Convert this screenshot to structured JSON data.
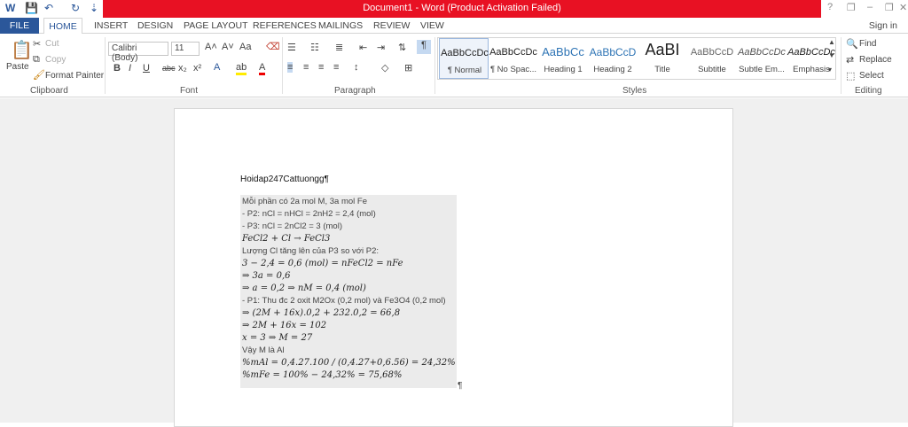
{
  "window": {
    "title": "Document1 - Word (Product Activation Failed)",
    "help": "?",
    "min": "–",
    "restore": "❐",
    "close": "✕"
  },
  "qat": {
    "app_icon": "W",
    "save": "💾",
    "undo": "↶",
    "redo": "↻",
    "more": "⇣"
  },
  "tabs": {
    "file": "FILE",
    "home": "HOME",
    "insert": "INSERT",
    "design": "DESIGN",
    "page_layout": "PAGE LAYOUT",
    "references": "REFERENCES",
    "mailings": "MAILINGS",
    "review": "REVIEW",
    "view": "VIEW",
    "signin": "Sign in"
  },
  "clipboard": {
    "paste": "Paste",
    "cut": "Cut",
    "copy": "Copy",
    "format_painter": "Format Painter",
    "label": "Clipboard"
  },
  "font": {
    "name": "Calibri (Body)",
    "size": "11",
    "label": "Font",
    "bold": "B",
    "italic": "I",
    "underline": "U",
    "strike": "abc",
    "sub": "x₂",
    "sup": "x²"
  },
  "paragraph": {
    "label": "Paragraph",
    "pilcrow": "¶"
  },
  "styles": {
    "label": "Styles",
    "items": [
      {
        "preview": "AaBbCcDc",
        "name": "¶ Normal"
      },
      {
        "preview": "AaBbCcDc",
        "name": "¶ No Spac..."
      },
      {
        "preview": "AaBbCc",
        "name": "Heading 1"
      },
      {
        "preview": "AaBbCcD",
        "name": "Heading 2"
      },
      {
        "preview": "AaBI",
        "name": "Title"
      },
      {
        "preview": "AaBbCcD",
        "name": "Subtitle"
      },
      {
        "preview": "AaBbCcDc",
        "name": "Subtle Em..."
      },
      {
        "preview": "AaBbCcDc",
        "name": "Emphasis"
      }
    ]
  },
  "editing": {
    "label": "Editing",
    "find": "Find",
    "replace": "Replace",
    "select": "Select"
  },
  "doc": {
    "heading": "Hoidap247Cattuongg¶",
    "endmark": "¶",
    "lines": [
      {
        "t": "Mỗi phần có 2a mol M, 3a mol Fe",
        "math": false
      },
      {
        "t": "- P2: nCl = nHCl = 2nH2 = 2,4 (mol)",
        "math": false
      },
      {
        "t": "- P3: nCl = 2nCl2 = 3 (mol)",
        "math": false
      },
      {
        "t": "FeCl2 + Cl → FeCl3",
        "math": true
      },
      {
        "t": "Lượng Cl tăng lên của P3 so với P2:",
        "math": false
      },
      {
        "t": "3 − 2,4 = 0,6 (mol) = nFeCl2 = nFe",
        "math": true
      },
      {
        "t": "⇒ 3a = 0,6",
        "math": true
      },
      {
        "t": "⇒ a = 0,2 ⇒ nM = 0,4 (mol)",
        "math": true
      },
      {
        "t": "- P1: Thu đc 2 oxit M2Ox (0,2 mol) và Fe3O4 (0,2 mol)",
        "math": false
      },
      {
        "t": "⇒ (2M + 16x).0,2 + 232.0,2 = 66,8",
        "math": true
      },
      {
        "t": "⇒ 2M + 16x = 102",
        "math": true
      },
      {
        "t": "x = 3 ⇒ M = 27",
        "math": true
      },
      {
        "t": "Vậy M là Al",
        "math": false
      },
      {
        "t": "%mAl = 0,4.27.100 / (0,4.27+0,6.56) = 24,32%",
        "math": true
      },
      {
        "t": "%mFe = 100% − 24,32% = 75,68%",
        "math": true
      }
    ]
  }
}
